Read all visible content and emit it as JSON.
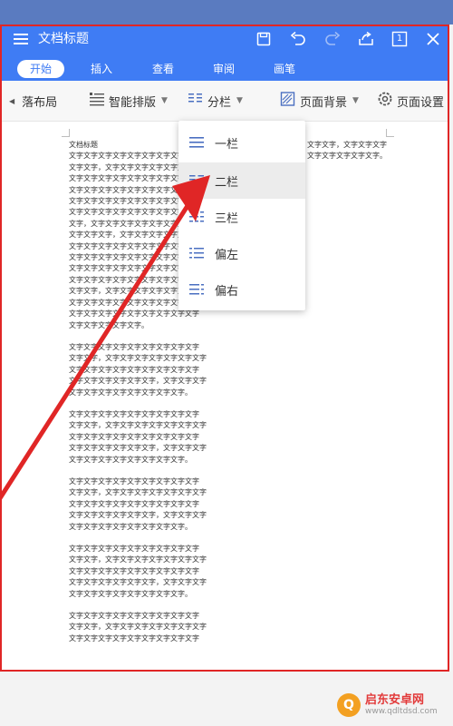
{
  "titlebar": {
    "title": "文档标题",
    "page_badge": "1",
    "icons": [
      "menu-icon",
      "save-icon",
      "undo-icon",
      "redo-icon",
      "share-icon",
      "page-icon",
      "close-icon"
    ]
  },
  "tabs": [
    "开始",
    "插入",
    "查看",
    "审阅",
    "画笔"
  ],
  "toolbar": {
    "paragraph_layout": "落布局",
    "smart_layout": "智能排版",
    "columns": "分栏",
    "page_background": "页面背景",
    "page_settings": "页面设置"
  },
  "dropdown": {
    "items": [
      {
        "label": "一栏",
        "icon": "one-column-icon"
      },
      {
        "label": "二栏",
        "icon": "two-column-icon",
        "selected": true
      },
      {
        "label": "三栏",
        "icon": "three-column-icon"
      },
      {
        "label": "偏左",
        "icon": "left-column-icon"
      },
      {
        "label": "偏右",
        "icon": "right-column-icon"
      }
    ]
  },
  "document": {
    "title_line": "文档标题",
    "left_column": [
      [
        "文字文字文字文字文字文字文字文字文字",
        "文字文字，文字文字文字文字文字文字，文",
        "文字文字文字文字文字文字文字文字，文",
        "文字文字文字文字文字文字文字文字文字",
        "文字文字文字文字文字文字文字文字文字",
        "文字文字文字文字文字文字文字文字文字",
        "文字，文字文字文字文字文字文字文字文",
        "文字文字文字，文字文字文字文字文字文",
        "文字文字文字文字文字文字文字文字文字",
        "文字文字文字文字文字文字文字文字文字",
        "文字文字文字文字文字文字文字文字文字",
        "文字文字文字文字文字文字文字文字文字",
        "文字文字，文字文字文字文字文字文字文",
        "文字文字文字文字文字文字文字文字文字",
        "文字文字文字文字文字文字文字文字文字",
        "文字文字文字文字文字。"
      ],
      [
        "文字文字文字文字文字文字文字文字文字",
        "文字文字，文字文字文字文字文字文字文字",
        "文字文字文字文字文字文字文字文字文字",
        "文字文字文字文字文字文字，文字文字文字",
        "文字文字文字文字文字文字文字文字。"
      ],
      [
        "文字文字文字文字文字文字文字文字文字",
        "文字文字，文字文字文字文字文字文字文字",
        "文字文字文字文字文字文字文字文字文字",
        "文字文字文字文字文字文字，文字文字文字",
        "文字文字文字文字文字文字文字文字。"
      ],
      [
        "文字文字文字文字文字文字文字文字文字",
        "文字文字，文字文字文字文字文字文字文字",
        "文字文字文字文字文字文字文字文字文字",
        "文字文字文字文字文字文字，文字文字文字",
        "文字文字文字文字文字文字文字文字。"
      ],
      [
        "文字文字文字文字文字文字文字文字文字",
        "文字文字，文字文字文字文字文字文字文字",
        "文字文字文字文字文字文字文字文字文字",
        "文字文字文字文字文字文字，文字文字文字",
        "文字文字文字文字文字文字文字文字。"
      ],
      [
        "文字文字文字文字文字文字文字文字文字",
        "文字文字，文字文字文字文字文字文字文字",
        "文字文字文字文字文字文字文字文字文字"
      ]
    ],
    "right_column": [
      "文字文字，文字文字文字",
      "文字文字文字文字文字。"
    ]
  },
  "watermark": {
    "name": "启东安卓网",
    "url": "www.qdltdsd.com"
  },
  "colors": {
    "brand_blue": "#3f7cf4",
    "annotation_red": "#e02626"
  }
}
